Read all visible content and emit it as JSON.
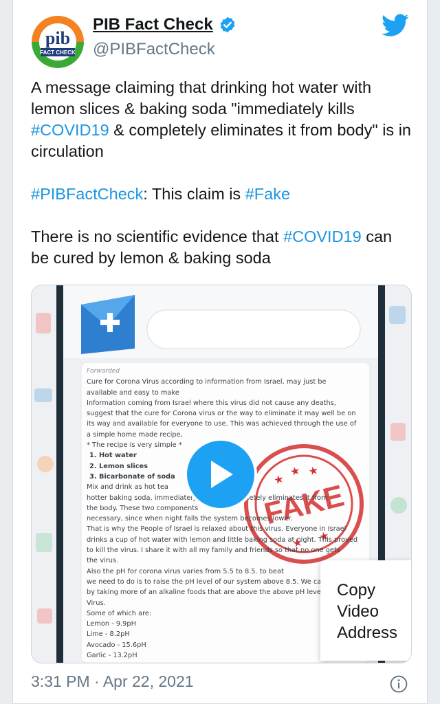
{
  "author": {
    "display_name": "PIB Fact Check",
    "handle": "@PIBFactCheck",
    "avatar_text_top": "pib",
    "avatar_text_bottom": "FACT CHECK"
  },
  "tweet": {
    "p1_a": "A message claiming that drinking hot water with lemon slices & baking soda \"immediately kills ",
    "p1_tag": "#COVID19",
    "p1_b": " & completely eliminates it from body\" is in circulation",
    "p2_tag1": "#PIBFactCheck",
    "p2_mid": ": This claim is ",
    "p2_tag2": "#Fake",
    "p3_a": "There is no scientific evidence that ",
    "p3_tag": "#COVID19",
    "p3_b": " can be cured by lemon & baking soda"
  },
  "media": {
    "doc_lines": [
      "Forwarded",
      "Cure for Corona Virus according to information from Israel, may just be",
      "available and easy to make",
      "Information coming from Israel where this virus did not cause any deaths,",
      "suggest that the cure for Corona virus or the way to eliminate it may well be on",
      "its way and available for everyone to use. This was achieved through the use of",
      "a simple home made recipe,",
      "* The recipe is very simple *",
      "1. Hot water",
      "2. Lemon slices",
      "3. Bicarbonate of soda",
      "Mix and drink as hot tea",
      "hotter baking soda, immediately kills and completely eliminates it from",
      "the body. These two components",
      "necessary, since when night falls the system becomes lower.",
      "That is why the People of Israel is relaxed about this virus. Everyone in Israel",
      "drinks a cup of hot water with lemon and little baking soda at night. This proved",
      "to kill the virus. I share it with all my family and friends so that no one gets",
      "the virus.",
      "Also the pH for corona virus varies from 5.5 to 8.5. to beat",
      "we need to do is to raise the pH level of our system above 8.5. We can",
      "by taking more of an alkaline foods that are above the above pH level",
      "Virus.",
      "Some of which are:",
      "Lemon - 9.9pH",
      "Lime - 8.2pH",
      "Avocado - 15.6pH",
      "Garlic - 13.2pH"
    ],
    "stamp_text": "FAKE",
    "context_menu": [
      "Copy",
      "Video",
      "Address"
    ]
  },
  "meta": {
    "timestamp": "3:31 PM · Apr 22, 2021"
  },
  "colors": {
    "link": "#1b95e0",
    "play": "#1da1f2",
    "stamp": "#d42f2f"
  }
}
